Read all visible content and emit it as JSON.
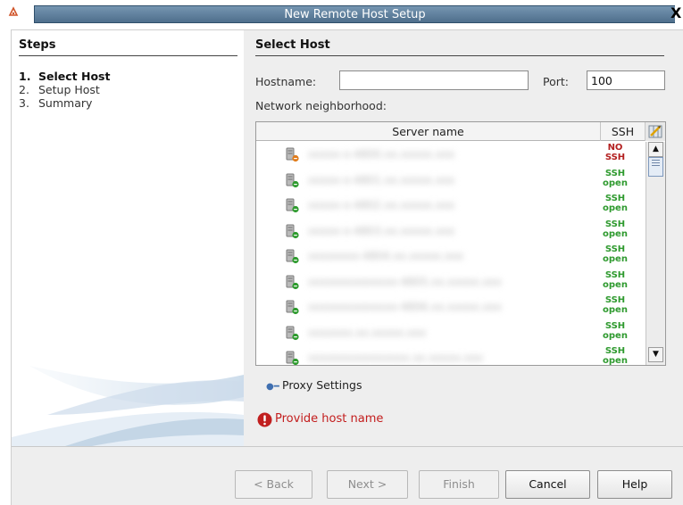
{
  "window": {
    "title": "New Remote Host Setup",
    "close_glyph": "X",
    "app_icon": "app-icon"
  },
  "steps": {
    "title": "Steps",
    "items": [
      {
        "num": "1.",
        "label": "Select Host",
        "current": true
      },
      {
        "num": "2.",
        "label": "Setup Host",
        "current": false
      },
      {
        "num": "3.",
        "label": "Summary",
        "current": false
      }
    ]
  },
  "main": {
    "title": "Select Host",
    "hostname_label": "Hostname:",
    "hostname_value": "",
    "port_label": "Port:",
    "port_value": "100",
    "network_label": "Network neighborhood:"
  },
  "table": {
    "col_server": "Server name",
    "col_ssh": "SSH",
    "rows": [
      {
        "name": "xxxxx-x-4800.xx.xxxxx.xxx",
        "ssh": [
          "NO",
          "SSH"
        ],
        "status": "no"
      },
      {
        "name": "xxxxx-x-4801.xx.xxxxx.xxx",
        "ssh": [
          "SSH",
          "open"
        ],
        "status": "open"
      },
      {
        "name": "xxxxx-x-4802.xx.xxxxx.xxx",
        "ssh": [
          "SSH",
          "open"
        ],
        "status": "open"
      },
      {
        "name": "xxxxx-x-4803.xx.xxxxx.xxx",
        "ssh": [
          "SSH",
          "open"
        ],
        "status": "open"
      },
      {
        "name": "xxxxxxxx-4804.xx.xxxxx.xxx",
        "ssh": [
          "SSH",
          "open"
        ],
        "status": "open"
      },
      {
        "name": "xxxxxxxxxxxxxx-4805.xx.xxxxx.xxx",
        "ssh": [
          "SSH",
          "open"
        ],
        "status": "open"
      },
      {
        "name": "xxxxxxxxxxxxxx-4806.xx.xxxxx.xxx",
        "ssh": [
          "SSH",
          "open"
        ],
        "status": "open"
      },
      {
        "name": "xxxxxxx.xx.xxxxx.xxx",
        "ssh": [
          "SSH",
          "open"
        ],
        "status": "open"
      },
      {
        "name": "xxxxxxxxxxxxxxxx.xx.xxxxx.xxx",
        "ssh": [
          "SSH",
          "open"
        ],
        "status": "open"
      }
    ]
  },
  "proxy": {
    "label": "Proxy Settings"
  },
  "error": {
    "message": "Provide host name"
  },
  "buttons": {
    "back": "< Back",
    "next": "Next >",
    "finish": "Finish",
    "cancel": "Cancel",
    "help": "Help"
  },
  "colors": {
    "titlebar": "#5f7f9c",
    "ssh_open": "#2f9a2f",
    "ssh_no": "#b32020",
    "error": "#c31d1d"
  }
}
